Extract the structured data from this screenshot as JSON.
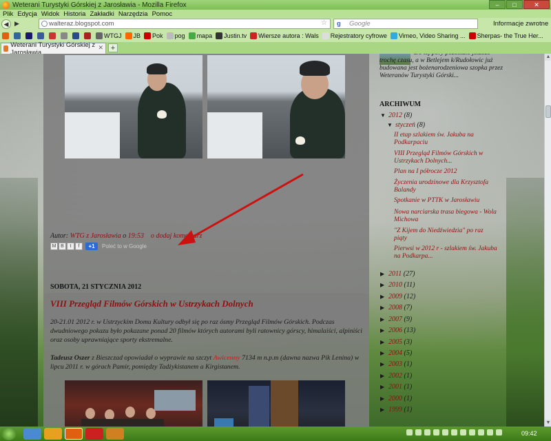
{
  "window": {
    "title": "Weterani Turystyki Górskiej z Jarosławia - Mozilla Firefox",
    "btn_min": "–",
    "btn_max": "□",
    "btn_close": "✕"
  },
  "menu": [
    "Plik",
    "Edycja",
    "Widok",
    "Historia",
    "Zakładki",
    "Narzędzia",
    "Pomoc"
  ],
  "nav": {
    "back": "◀",
    "forward": "▶",
    "url": "walteraz.blogspot.com",
    "search_placeholder": "Google",
    "feedback": "Informacje zwrotne ▾"
  },
  "bookmarks": [
    {
      "label": "",
      "color": "#e06010"
    },
    {
      "label": "",
      "color": "#336699"
    },
    {
      "label": "",
      "color": "#1a1a6a"
    },
    {
      "label": "",
      "color": "#3a5a9a"
    },
    {
      "label": "",
      "color": "#cc3333"
    },
    {
      "label": "",
      "color": "#888888"
    },
    {
      "label": "",
      "color": "#2a4a8a"
    },
    {
      "label": "",
      "color": "#aa2222"
    },
    {
      "label": "WTGJ",
      "color": "#666666"
    },
    {
      "label": "JB",
      "color": "#ff6600"
    },
    {
      "label": "Pok",
      "color": "#cc0000"
    },
    {
      "label": "pog",
      "color": "#bbbbbb"
    },
    {
      "label": "mapa",
      "color": "#44aa44"
    },
    {
      "label": "Justin.tv",
      "color": "#333333"
    },
    {
      "label": "Wiersze autora : Wals",
      "color": "#cc2222"
    },
    {
      "label": "Rejestratory cyfrowe",
      "color": "#dddddd"
    },
    {
      "label": "Vimeo, Video Sharing ...",
      "color": "#33aadd"
    },
    {
      "label": "Sherpas- the True Her...",
      "color": "#cc0000"
    }
  ],
  "tab": {
    "title": "Weterani Turystyki Górskiej z Jarosławia",
    "new_tab": "+"
  },
  "post1": {
    "author_prefix": "Autor: ",
    "author": "WTG z Jarosławia",
    "at": " o ",
    "time": "19:53",
    "comment": "o dodaj komentarz",
    "share_buttons": [
      "M",
      "B",
      "t",
      "f"
    ],
    "plus1": "+1",
    "recommend": "Poleć to w Google"
  },
  "date_header": "SOBOTA, 21 STYCZNIA 2012",
  "post2": {
    "title": "VIII Przegląd Filmów Górskich w Ustrzykach Dolnych",
    "para1": "20-21.01 2012 r. w Ustrzyckim Domu Kultury odbył się po raz ósmy Przegląd Filmów Górskich. Podczas dwudniowego pokazu było pokazane ponad 20 filmów  których autorami byli ratownicy górscy, himalaiści, alpiniści oraz osoby uprawniające sporty ekstremalne.",
    "person": "Tadeusz Oszer",
    "para2_a": "  z Bieszczad opowiadał o wyprawie na szczyt ",
    "peak": "Awicenny",
    "para2_b": " 7134 m n.p.m (dawna nazwa Pik Lenina) w lipcu 2011 r. w górach Pamir, pomiędzy Tadżykistanem a Kirgistanem."
  },
  "sidebar": {
    "top_text": "Do tej pory pozostało jeszcze trochę czasu, a w Betlejem k/Rudołowic już budowana jest bożenarodzeniowa szopka przez Weteranów Turystyki Górski...",
    "archive_title": "ARCHIWUM",
    "year_2012": {
      "tri": "▼",
      "label": "2012",
      "count": " (8)"
    },
    "month": {
      "tri": "▼",
      "label": "styczeń",
      "count": " (8)"
    },
    "posts": [
      "II etap szlakiem św. Jakuba na Podkarpaciu",
      "VIII Przegląd Filmów Górskich w Ustrzykach Dolnych...",
      "Plan na I półrocze 2012",
      "Życzenia urodzinowe dla Krzysztofa Balandy",
      "Spotkanie w PTTK w Jarosławiu",
      "Nowa narciarska trasa biegowa - Wola Michowa",
      "\"Z Kijem do Niedźwiedzia\" po raz piąty",
      "Pierwsi w 2012 r - szlakiem św. Jakuba na Podkarpa..."
    ],
    "years": [
      {
        "tri": "▶",
        "label": "2011",
        "count": " (27)"
      },
      {
        "tri": "▶",
        "label": "2010",
        "count": " (11)"
      },
      {
        "tri": "▶",
        "label": "2009",
        "count": " (12)"
      },
      {
        "tri": "▶",
        "label": "2008",
        "count": " (7)"
      },
      {
        "tri": "▶",
        "label": "2007",
        "count": " (9)"
      },
      {
        "tri": "▶",
        "label": "2006",
        "count": " (13)"
      },
      {
        "tri": "▶",
        "label": "2005",
        "count": " (3)"
      },
      {
        "tri": "▶",
        "label": "2004",
        "count": " (5)"
      },
      {
        "tri": "▶",
        "label": "2003",
        "count": " (1)"
      },
      {
        "tri": "▶",
        "label": "2002",
        "count": " (1)"
      },
      {
        "tri": "▶",
        "label": "2001",
        "count": " (1)"
      },
      {
        "tri": "▶",
        "label": "2000",
        "count": " (1)"
      },
      {
        "tri": "▶",
        "label": "1999",
        "count": " (1)"
      }
    ]
  },
  "scroll": {
    "up": "▲",
    "down": "▼"
  },
  "taskbar": {
    "clock": "09:42"
  },
  "colors": {
    "link": "#8b1010",
    "arrow": "#cc1111",
    "post_bg": "#7d7d7d"
  }
}
